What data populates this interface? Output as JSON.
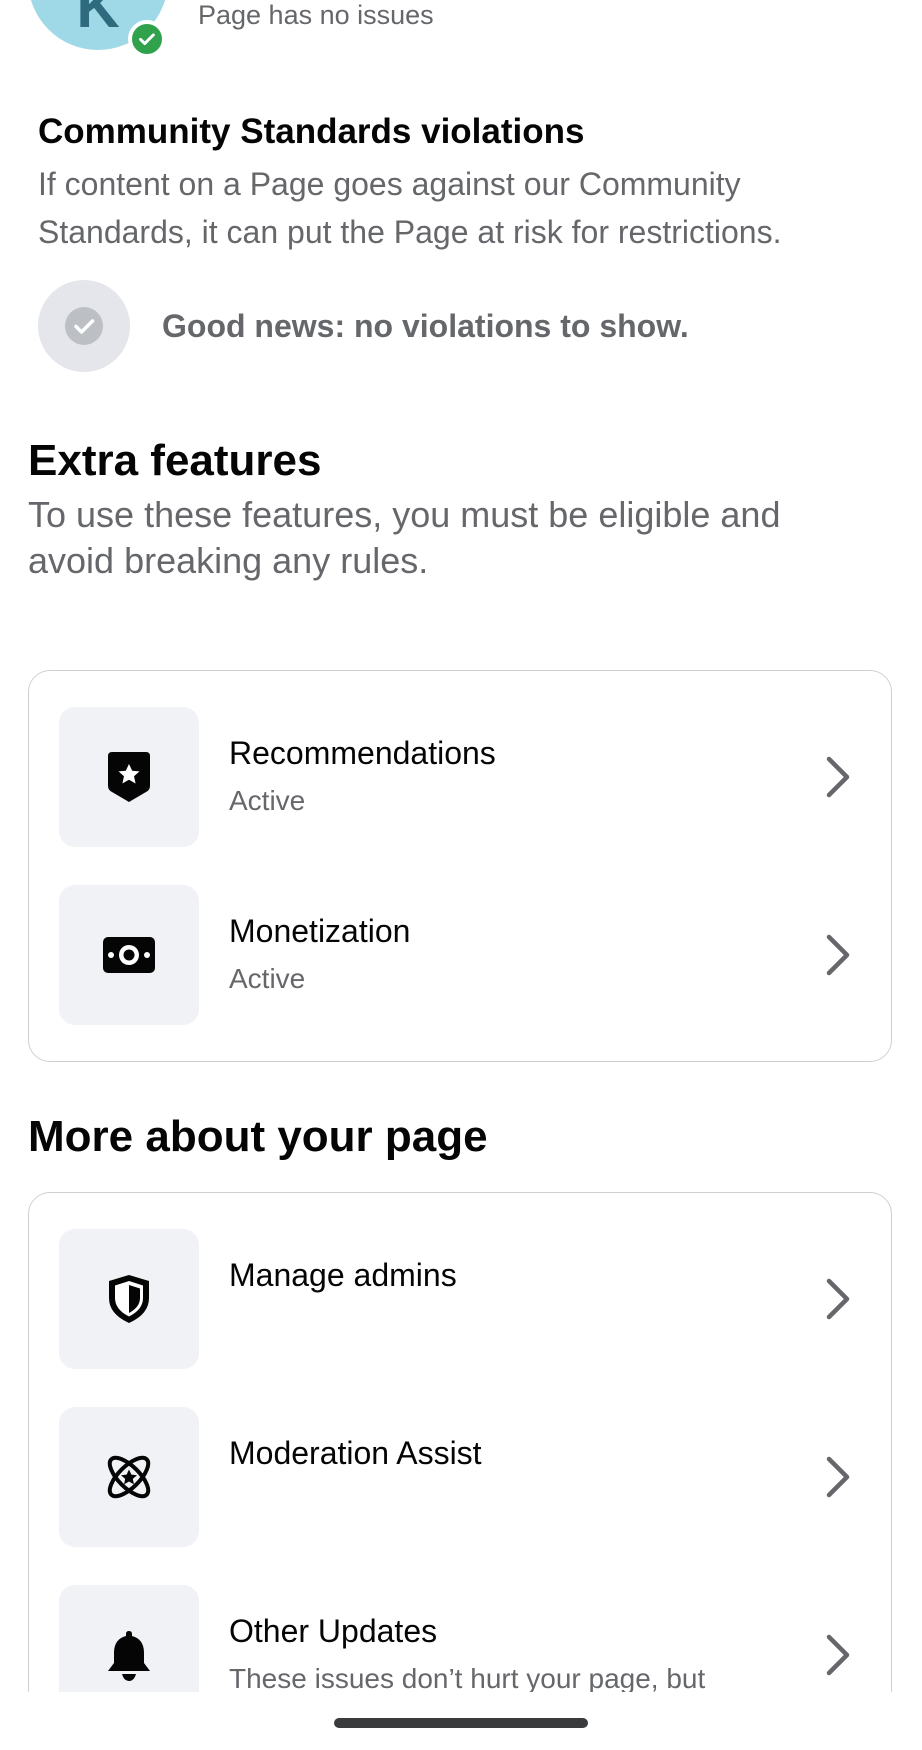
{
  "header": {
    "page_status": "Page has no issues",
    "avatar_letter": "K"
  },
  "community_standards": {
    "title": "Community Standards violations",
    "description": "If content on a Page goes against our Community Standards, it can put the Page at risk for restrictions.",
    "status": "Good news: no violations to show."
  },
  "extra_features": {
    "title": "Extra features",
    "description": "To use these features, you must be eligible and avoid breaking any rules.",
    "items": [
      {
        "label": "Recommendations",
        "status": "Active",
        "icon": "badge-star-icon"
      },
      {
        "label": "Monetization",
        "status": "Active",
        "icon": "money-icon"
      }
    ]
  },
  "more_about": {
    "title": "More about your page",
    "items": [
      {
        "label": "Manage admins",
        "icon": "shield-icon"
      },
      {
        "label": "Moderation Assist",
        "icon": "atom-star-icon"
      },
      {
        "label": "Other Updates",
        "description": "These issues don’t hurt your page, but",
        "icon": "bell-icon"
      }
    ]
  },
  "colors": {
    "success_green": "#31a24c",
    "secondary_text": "#65676b",
    "tile_background": "#f0f2f5"
  }
}
